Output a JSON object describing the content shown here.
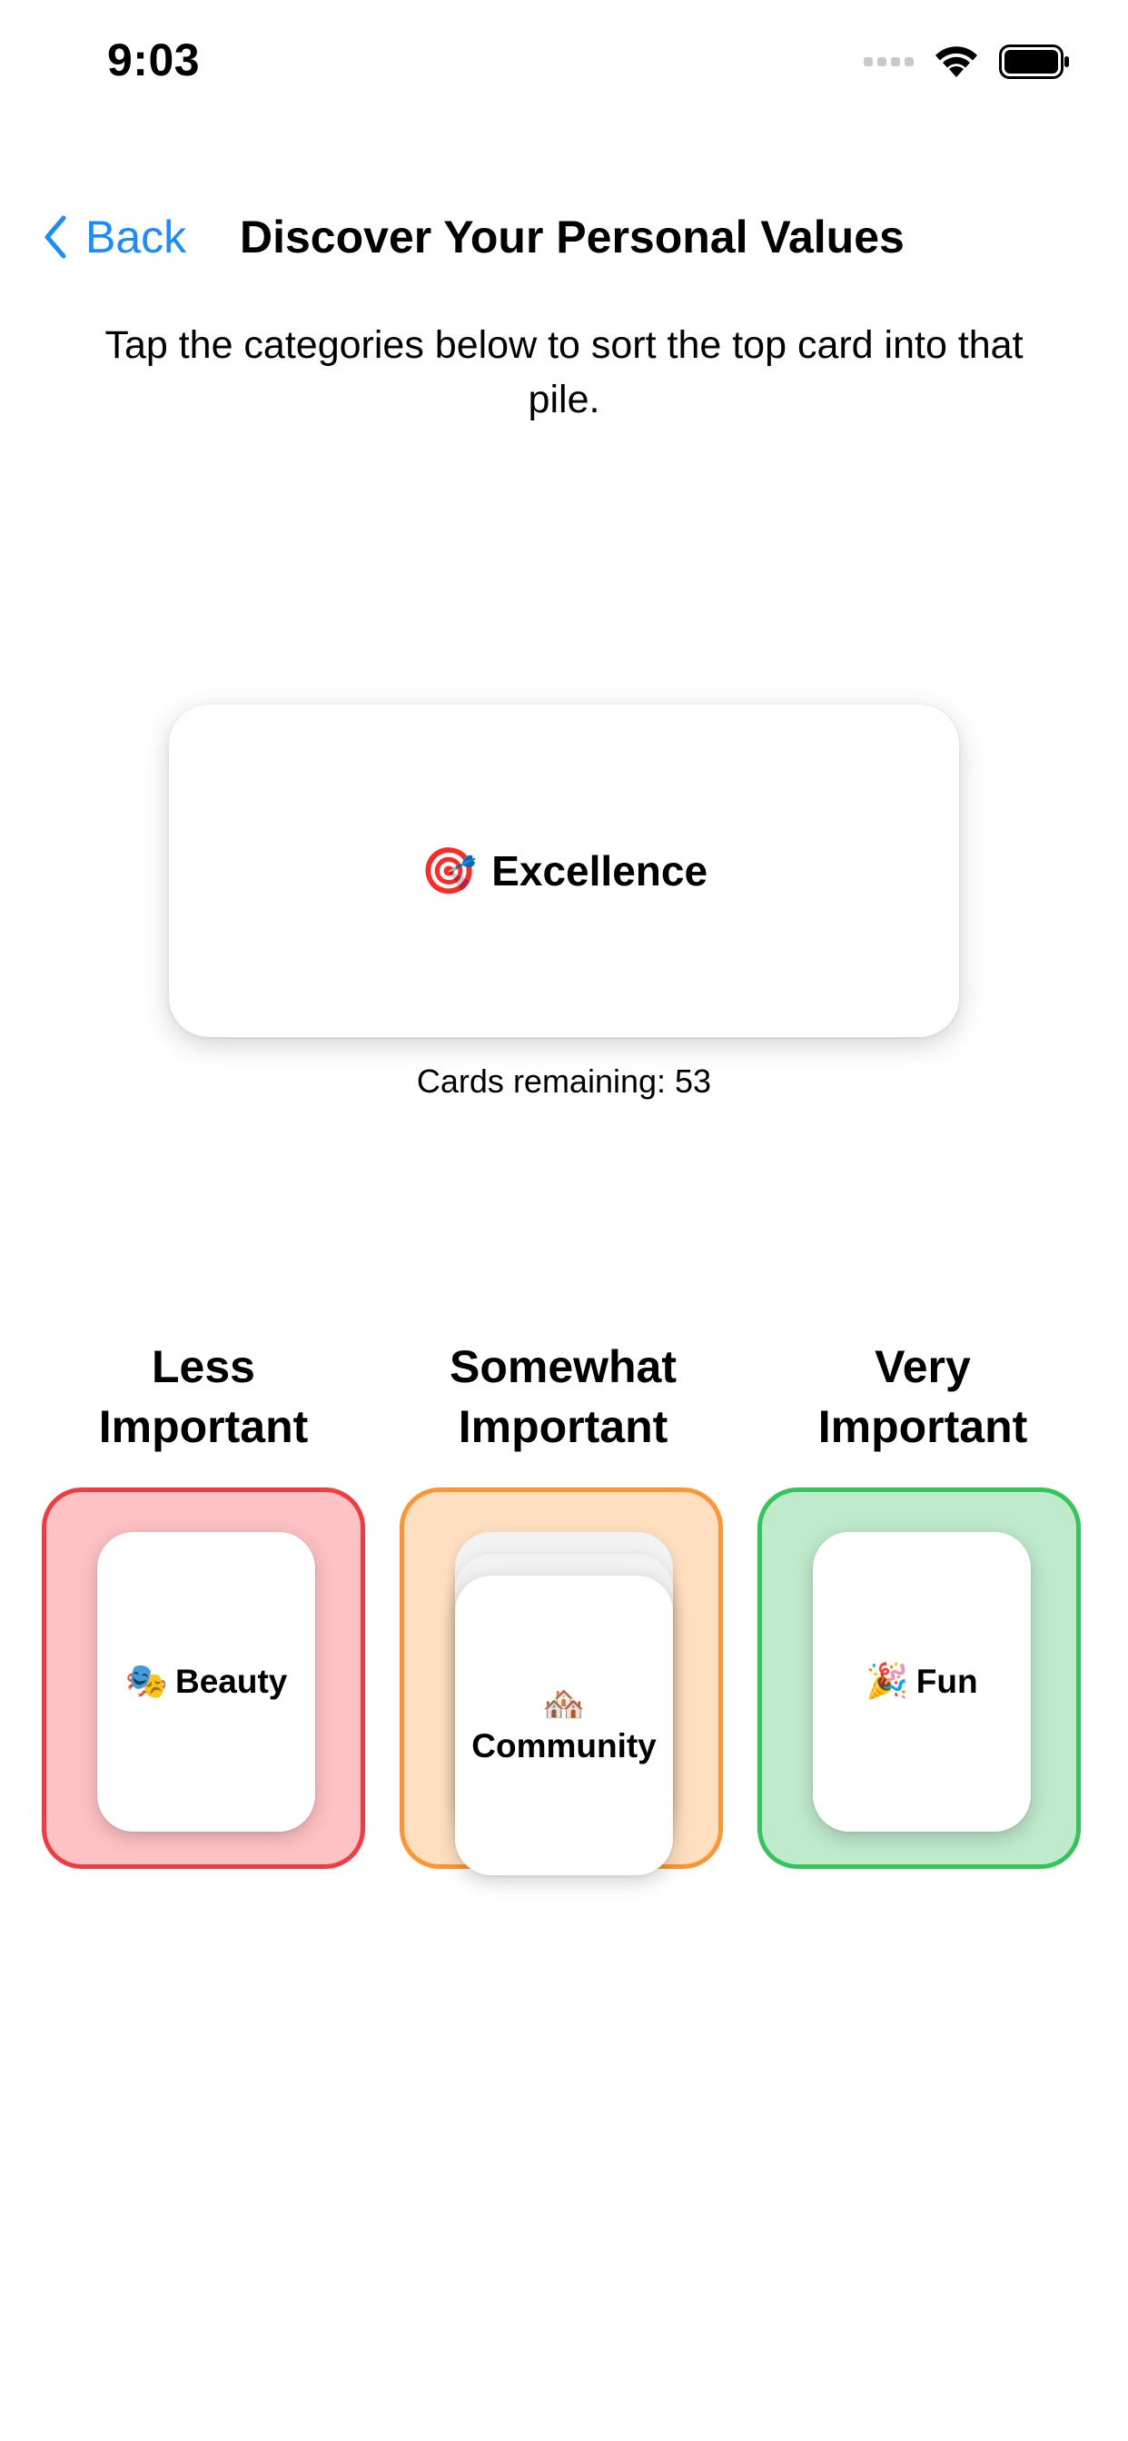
{
  "status_bar": {
    "time": "9:03"
  },
  "nav": {
    "back_label": "Back",
    "title": "Discover Your Personal Values"
  },
  "instructions": "Tap the categories below to sort the top card into that pile.",
  "top_card": {
    "emoji": "🎯",
    "label": "Excellence"
  },
  "remaining": {
    "label": "Cards remaining:",
    "count": "53"
  },
  "categories": [
    {
      "title_line1": "Less",
      "title_line2": "Important",
      "color": "#f23b3f",
      "fill": "#ffc2c4",
      "top_card": {
        "emoji": "🎭",
        "label": "Beauty"
      }
    },
    {
      "title_line1": "Somewhat",
      "title_line2": "Important",
      "color": "#ff9530",
      "fill": "#ffdfc0",
      "top_card": {
        "emoji": "🏘️",
        "label": "Community"
      }
    },
    {
      "title_line1": "Very",
      "title_line2": "Important",
      "color": "#33c45a",
      "fill": "#bfeacc",
      "top_card": {
        "emoji": "🎉",
        "label": "Fun"
      }
    }
  ],
  "colors": {
    "accent": "#1a8cff"
  }
}
